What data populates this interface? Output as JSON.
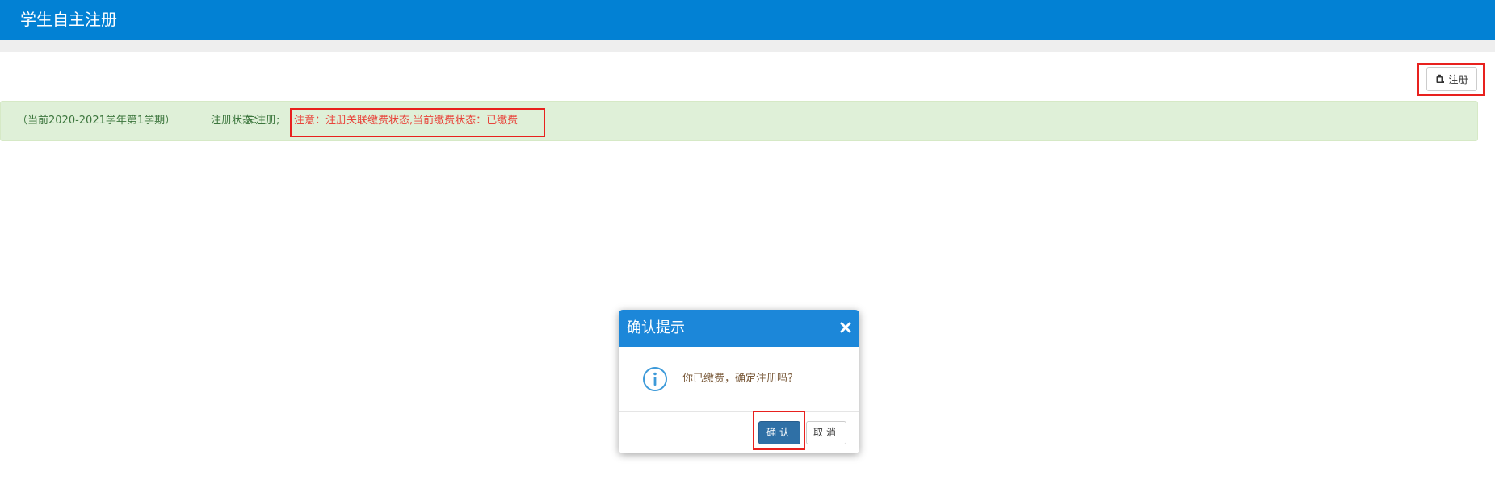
{
  "app": {
    "title": "学生自主注册"
  },
  "toolbar": {
    "register_label": "注册",
    "register_icon": "clipboard-icon"
  },
  "alert": {
    "term": "（当前2020-2021学年第1学期）",
    "status_label": "注册状态：",
    "status_value": "未注册;",
    "note": "注意：注册关联缴费状态,当前缴费状态：已缴费"
  },
  "dialog": {
    "title": "确认提示",
    "close_icon": "close-icon",
    "info_icon": "info-icon",
    "message": "你已缴费，确定注册吗?",
    "confirm_label": "确认",
    "cancel_label": "取消"
  },
  "colors": {
    "header_bg": "#0281d4",
    "alert_bg": "#dff0d8",
    "alert_text": "#3c763d",
    "note_text": "#e8433a",
    "dialog_header": "#1c87d9",
    "confirm_button": "#2f70a6",
    "highlight_border": "#e8211e"
  }
}
